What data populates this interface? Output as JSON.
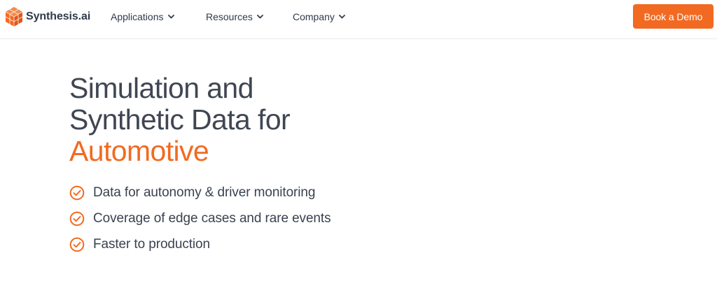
{
  "brand": {
    "name": "Synthesis.ai",
    "accent_color": "#f26a21",
    "logo_icon": "hexagon-cube-icon"
  },
  "nav": {
    "items": [
      {
        "label": "Applications",
        "icon": "chevron-down-icon"
      },
      {
        "label": "Resources",
        "icon": "chevron-down-icon"
      },
      {
        "label": "Company",
        "icon": "chevron-down-icon"
      }
    ],
    "cta_label": "Book a Demo"
  },
  "hero": {
    "title_line1": "Simulation and",
    "title_line2": "Synthetic Data for",
    "title_accent": "Automotive",
    "features": [
      {
        "text": "Data for autonomy & driver monitoring",
        "icon": "check-circle-icon"
      },
      {
        "text": "Coverage of edge cases and rare events",
        "icon": "check-circle-icon"
      },
      {
        "text": "Faster to production",
        "icon": "check-circle-icon"
      }
    ]
  }
}
